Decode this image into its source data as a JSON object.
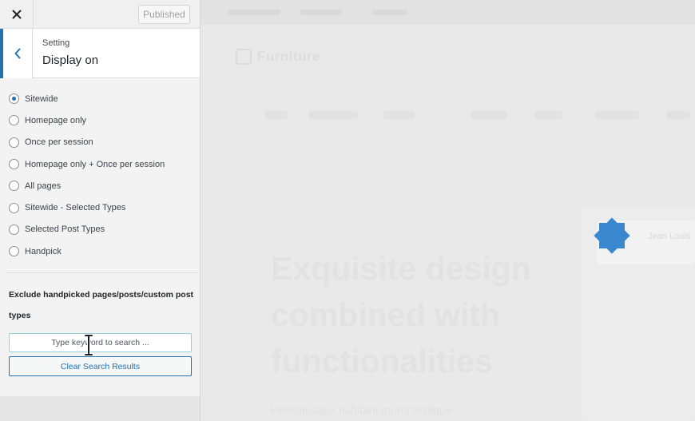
{
  "topbar": {
    "close_label": "×",
    "publish_label": "Published"
  },
  "section": {
    "small_label": "Setting",
    "title": "Display on"
  },
  "options": [
    {
      "label": "Sitewide",
      "checked": true
    },
    {
      "label": "Homepage only",
      "checked": false
    },
    {
      "label": "Once per session",
      "checked": false
    },
    {
      "label": "Homepage only + Once per session",
      "checked": false
    },
    {
      "label": "All pages",
      "checked": false
    },
    {
      "label": "Sitewide - Selected Types",
      "checked": false
    },
    {
      "label": "Selected Post Types",
      "checked": false
    },
    {
      "label": "Handpick",
      "checked": false
    }
  ],
  "exclude": {
    "label": "Exclude handpicked pages/posts/custom post types",
    "search_placeholder": "Type keyword to search ...",
    "clear_label": "Clear Search Results"
  },
  "preview": {
    "brand": "Furniture",
    "headline": "Exquisite design combined with functionalities",
    "subtext": "Pellentesque habitant morbi tristique",
    "card_name": "Jean Louis"
  },
  "colors": {
    "accent": "#2271b1",
    "badge": "#3b87cf"
  }
}
